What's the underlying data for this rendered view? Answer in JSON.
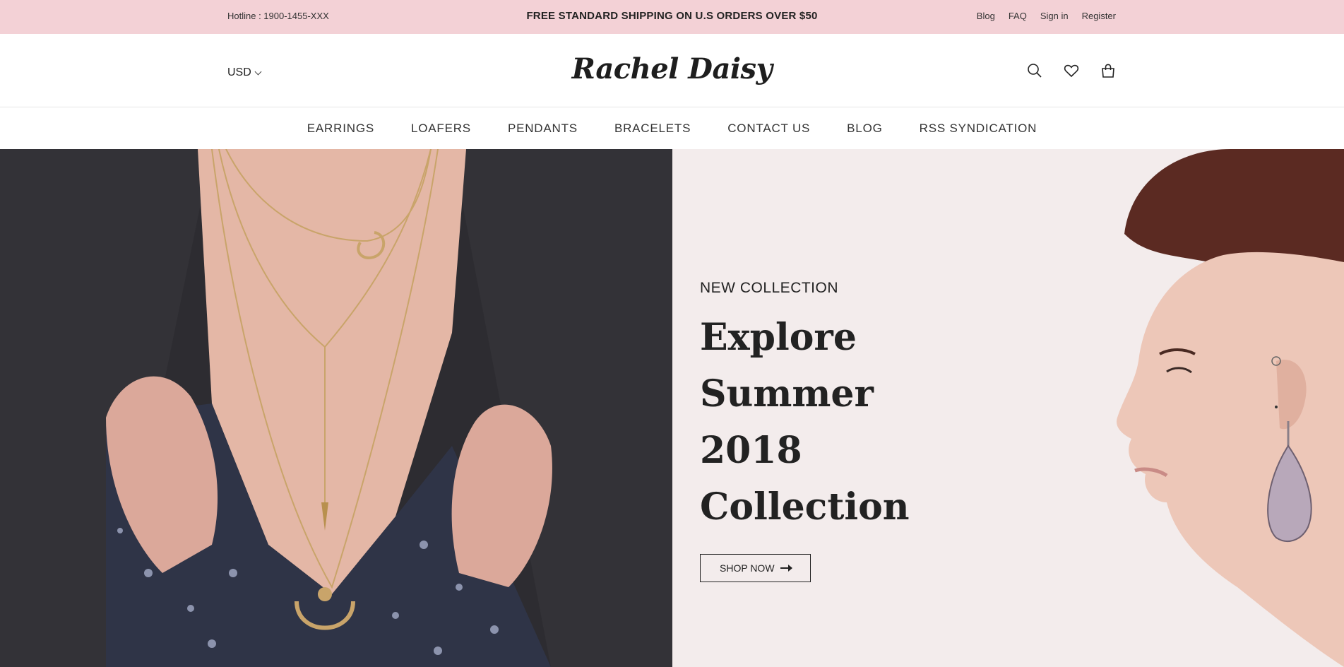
{
  "topbar": {
    "hotline": "Hotline : 1900-1455-XXX",
    "promo": "FREE STANDARD SHIPPING ON U.S ORDERS OVER $50",
    "links": [
      "Blog",
      "FAQ",
      "Sign in",
      "Register"
    ]
  },
  "header": {
    "currency": "USD",
    "logo": "Rachel Daisy",
    "icons": [
      "search-icon",
      "heart-icon",
      "shopping-bag-icon"
    ]
  },
  "nav": {
    "items": [
      "EARRINGS",
      "LOAFERS",
      "PENDANTS",
      "BRACELETS",
      "CONTACT US",
      "BLOG",
      "RSS SYNDICATION"
    ]
  },
  "hero": {
    "eyebrow": "NEW COLLECTION",
    "headline_line1": "Explore",
    "headline_line2": "Summer 2018",
    "headline_line3": "Collection",
    "button": "SHOP NOW"
  },
  "colors": {
    "topbar_bg": "#f3d1d6",
    "hero_right_bg": "#f3ecec",
    "text": "#222222"
  }
}
